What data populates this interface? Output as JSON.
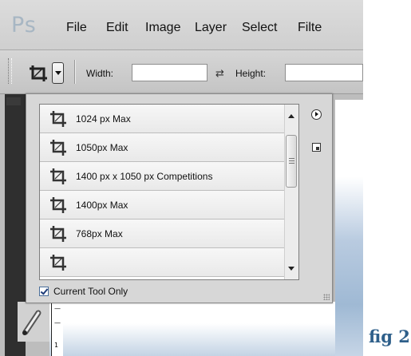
{
  "app": {
    "logo": "Ps",
    "menu": [
      "File",
      "Edit",
      "Image",
      "Layer",
      "Select",
      "Filte"
    ]
  },
  "options_bar": {
    "tool_icon": "crop-icon",
    "preset_dropdown_icon": "triangle-down-icon",
    "width_label": "Width:",
    "width_value": "",
    "swap_icon": "swap-arrows-icon",
    "height_label": "Height:",
    "height_value": ""
  },
  "preset_panel": {
    "presets": [
      {
        "label": "1024 px Max",
        "icon": "crop-icon"
      },
      {
        "label": "1050px Max",
        "icon": "crop-icon"
      },
      {
        "label": "1400 px x 1050 px Competitions",
        "icon": "crop-icon"
      },
      {
        "label": "1400px Max",
        "icon": "crop-icon"
      },
      {
        "label": "768px Max",
        "icon": "crop-icon"
      }
    ],
    "current_tool_only_label": "Current Tool Only",
    "current_tool_only_checked": true,
    "panel_menu_icon": "circle-arrow-right-icon",
    "new_preset_icon": "new-preset-icon"
  },
  "caption": "fig 2",
  "colors": {
    "caption": "#2e5f8a",
    "checkbox_border": "#4a6e9a"
  }
}
